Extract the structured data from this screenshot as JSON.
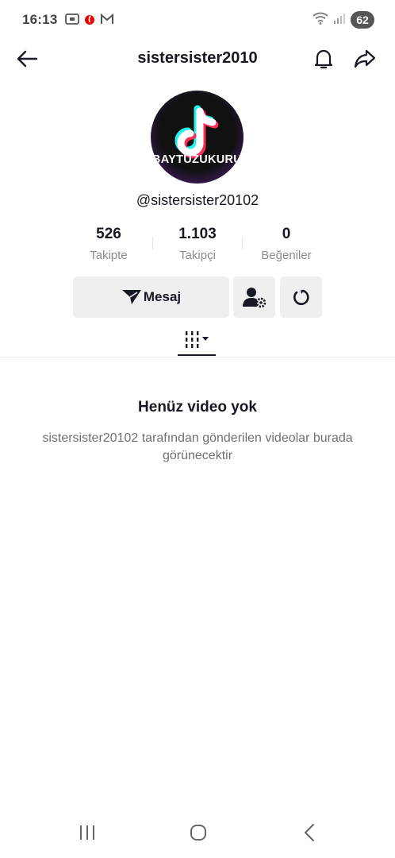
{
  "status_bar": {
    "time": "16:13",
    "battery": "62",
    "icons_left": [
      "screenshot-icon",
      "vodafone-icon",
      "gmail-icon"
    ],
    "icons_right": [
      "wifi-icon",
      "signal-icon",
      "battery-icon"
    ]
  },
  "header": {
    "title": "sistersister2010",
    "icons": [
      "back-arrow-icon",
      "bell-icon",
      "share-icon"
    ]
  },
  "profile": {
    "avatar_text": "BAYTUZUKURU",
    "handle": "@sistersister20102"
  },
  "stats": [
    {
      "value": "526",
      "label": "Takipte"
    },
    {
      "value": "1.103",
      "label": "Takipçi"
    },
    {
      "value": "0",
      "label": "Beğeniler"
    }
  ],
  "actions": {
    "message_label": "Mesaj"
  },
  "empty_state": {
    "title": "Henüz video yok",
    "subtitle": "sistersister20102 tarafından gönderilen videolar burada görünecektir"
  },
  "colors": {
    "text_primary": "#161823",
    "text_secondary": "#8a8b91",
    "button_bg": "#efeff0",
    "tiktok_cyan": "#25f4ee",
    "tiktok_red": "#fe2c55"
  }
}
